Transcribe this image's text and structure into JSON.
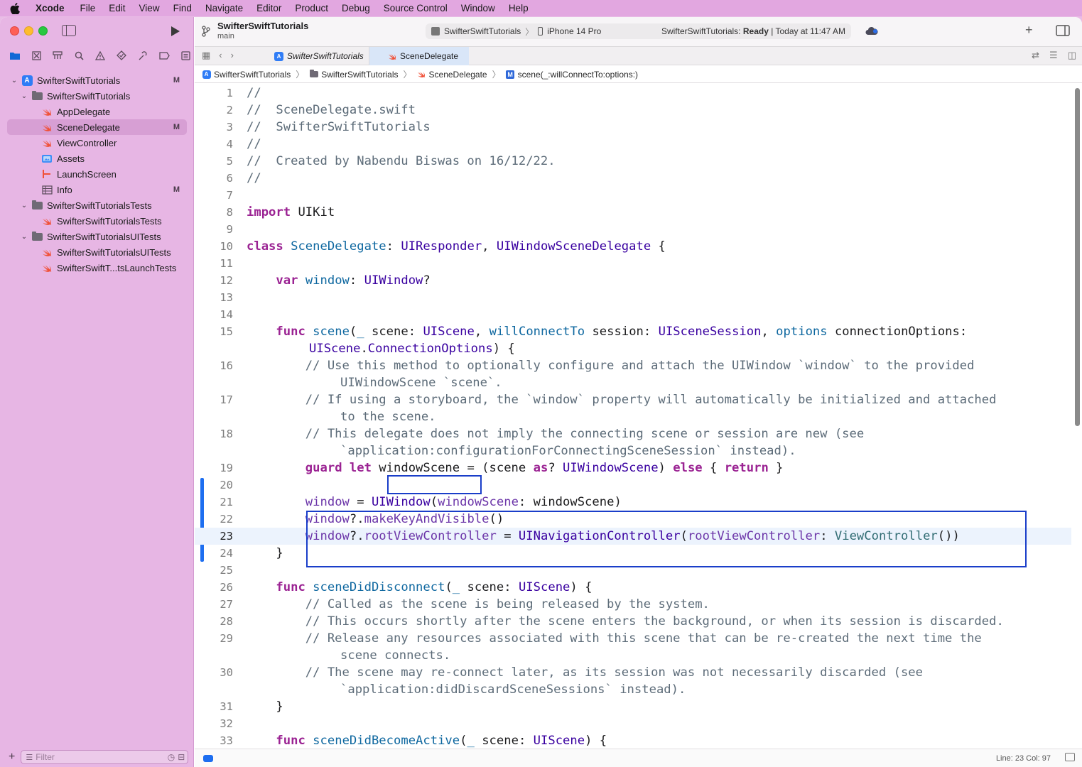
{
  "menubar": {
    "app": "Xcode",
    "items": [
      "File",
      "Edit",
      "View",
      "Find",
      "Navigate",
      "Editor",
      "Product",
      "Debug",
      "Source Control",
      "Window",
      "Help"
    ]
  },
  "toolbar": {
    "project_title": "SwifterSwiftTutorials",
    "branch": "main",
    "scheme": "SwifterSwiftTutorials",
    "device": "iPhone 14 Pro",
    "status_prefix": "SwifterSwiftTutorials:",
    "status_state": "Ready",
    "status_time": "| Today at 11:47 AM"
  },
  "navigator": {
    "tree": [
      {
        "label": "SwifterSwiftTutorials",
        "type": "project",
        "level": 0,
        "badge": "M"
      },
      {
        "label": "SwifterSwiftTutorials",
        "type": "folder",
        "level": 1,
        "badge": ""
      },
      {
        "label": "AppDelegate",
        "type": "swift",
        "level": 2,
        "badge": ""
      },
      {
        "label": "SceneDelegate",
        "type": "swift",
        "level": 2,
        "badge": "M",
        "selected": true
      },
      {
        "label": "ViewController",
        "type": "swift",
        "level": 2,
        "badge": ""
      },
      {
        "label": "Assets",
        "type": "assets",
        "level": 2,
        "badge": ""
      },
      {
        "label": "LaunchScreen",
        "type": "storyboard",
        "level": 2,
        "badge": ""
      },
      {
        "label": "Info",
        "type": "plist",
        "level": 2,
        "badge": "M"
      },
      {
        "label": "SwifterSwiftTutorialsTests",
        "type": "folder",
        "level": 1,
        "badge": ""
      },
      {
        "label": "SwifterSwiftTutorialsTests",
        "type": "swift",
        "level": 2,
        "badge": ""
      },
      {
        "label": "SwifterSwiftTutorialsUITests",
        "type": "folder",
        "level": 1,
        "badge": ""
      },
      {
        "label": "SwifterSwiftTutorialsUITests",
        "type": "swift",
        "level": 2,
        "badge": ""
      },
      {
        "label": "SwifterSwiftT...tsLaunchTests",
        "type": "swift",
        "level": 2,
        "badge": ""
      }
    ],
    "filter_placeholder": "Filter"
  },
  "tabs": {
    "tab1": "SwifterSwiftTutorials",
    "tab2": "SceneDelegate"
  },
  "jumpbar": [
    "SwifterSwiftTutorials",
    "SwifterSwiftTutorials",
    "SceneDelegate",
    "scene(_:willConnectTo:options:)"
  ],
  "editor": {
    "line_numbers": [
      "1",
      "2",
      "3",
      "4",
      "5",
      "6",
      "7",
      "8",
      "9",
      "10",
      "11",
      "12",
      "13",
      "14",
      "15",
      "",
      "16",
      "",
      "17",
      "",
      "18",
      "",
      "19",
      "20",
      "21",
      "22",
      "23",
      "24",
      "25",
      "26",
      "27",
      "28",
      "29",
      "",
      "30",
      "",
      "31",
      "32",
      "33"
    ]
  },
  "statusbar": {
    "position": "Line: 23  Col: 97"
  },
  "colors": {
    "keyword": "#9b2393",
    "type": "#3900a0",
    "comment": "#5d6c79",
    "accent": "#1d6ef0",
    "annotation": "#1a3ec9"
  }
}
